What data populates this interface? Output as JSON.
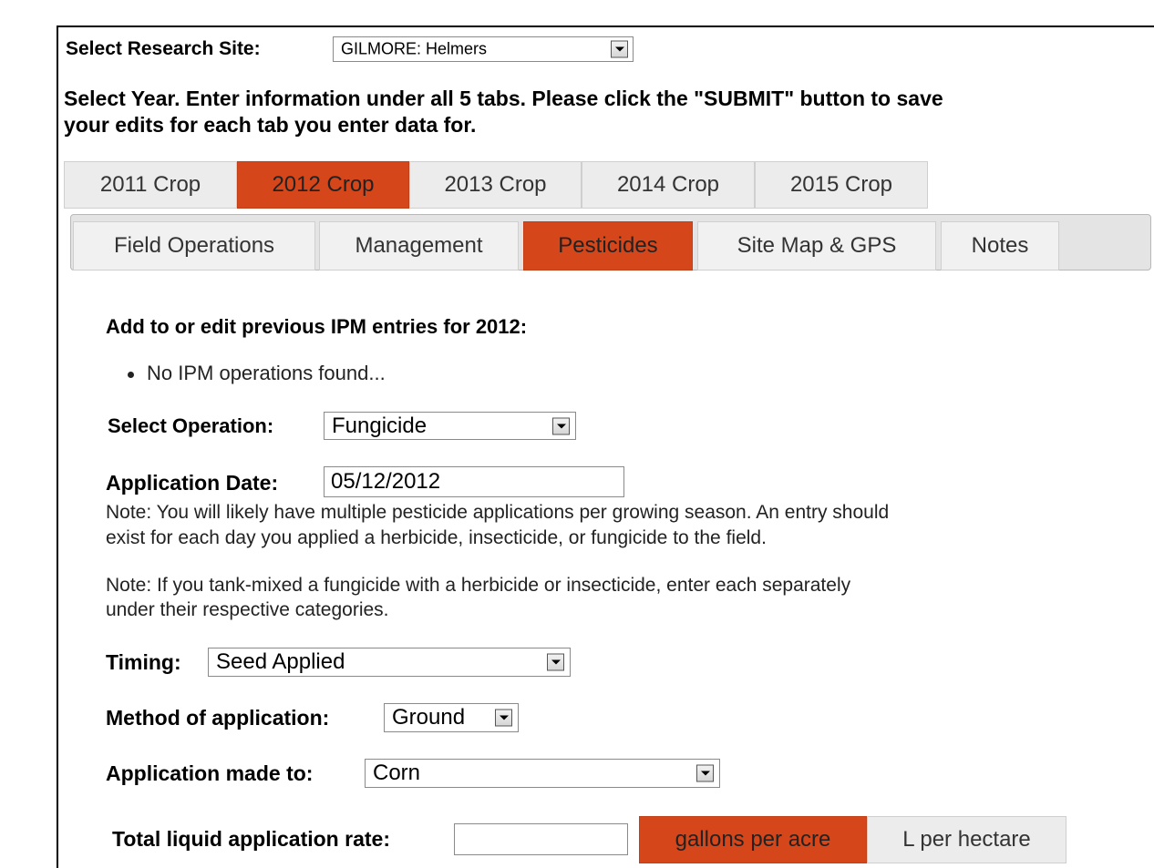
{
  "site": {
    "label": "Select Research Site:",
    "selected": "GILMORE: Helmers"
  },
  "instructions": {
    "line1": "Select Year. Enter information under all 5 tabs. Please click the \"SUBMIT\" button to save",
    "line2": "your edits for each tab you enter data for."
  },
  "year_tabs": [
    {
      "label": "2011 Crop",
      "active": false
    },
    {
      "label": "2012 Crop",
      "active": true
    },
    {
      "label": "2013 Crop",
      "active": false
    },
    {
      "label": "2014 Crop",
      "active": false
    },
    {
      "label": "2015 Crop",
      "active": false
    }
  ],
  "section_tabs": [
    {
      "label": "Field Operations",
      "active": false
    },
    {
      "label": "Management",
      "active": false
    },
    {
      "label": "Pesticides",
      "active": true
    },
    {
      "label": "Site Map & GPS",
      "active": false
    },
    {
      "label": "Notes",
      "active": false
    }
  ],
  "ipm": {
    "heading": "Add to or edit previous IPM entries for 2012:",
    "empty_message": "No IPM operations found..."
  },
  "form": {
    "operation": {
      "label": "Select Operation:",
      "value": "Fungicide"
    },
    "application_date": {
      "label": "Application Date:",
      "value": "05/12/2012"
    },
    "note1_line1": "Note: You will likely have multiple pesticide applications per growing season. An entry should",
    "note1_line2": "exist for each day you applied a herbicide, insecticide, or fungicide to the field.",
    "note2_line1": "Note: If you tank-mixed a fungicide with a herbicide or insecticide, enter each separately",
    "note2_line2": "under their respective categories.",
    "timing": {
      "label": "Timing:",
      "value": "Seed Applied"
    },
    "method": {
      "label": "Method of application:",
      "value": "Ground"
    },
    "made_to": {
      "label": "Application made to:",
      "value": "Corn"
    },
    "liquid_rate": {
      "label": "Total liquid application rate:",
      "value": "",
      "unit_options": [
        "gallons per acre",
        "L per hectare"
      ],
      "selected_unit": "gallons per acre"
    }
  },
  "colors": {
    "accent": "#d5461a",
    "tab_inactive": "#ececec"
  }
}
